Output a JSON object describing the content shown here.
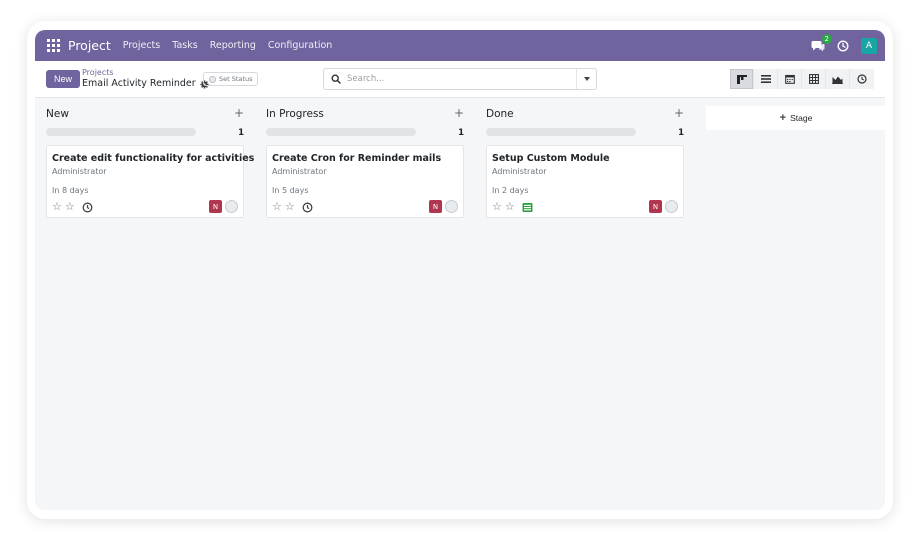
{
  "navbar": {
    "app_name": "Project",
    "menu": [
      "Projects",
      "Tasks",
      "Reporting",
      "Configuration"
    ],
    "chat_count": "2",
    "avatar_letter": "A",
    "color": "#71639e"
  },
  "control": {
    "new_label": "New",
    "breadcrumb_parent": "Projects",
    "breadcrumb_current": "Email Activity Reminder",
    "set_status_label": "Set Status",
    "search_placeholder": "Search..."
  },
  "views": [
    "kanban-icon",
    "list-icon",
    "calendar-icon",
    "pivot-icon",
    "graph-icon",
    "activity-icon"
  ],
  "kanban": {
    "add_stage_label": "Stage",
    "columns": [
      {
        "title": "New",
        "count": "1",
        "card": {
          "title": "Create edit functionality for activities",
          "user": "Administrator",
          "deadline": "In 8 days",
          "activity": "clock-icon",
          "avatar": "N"
        }
      },
      {
        "title": "In Progress",
        "count": "1",
        "card": {
          "title": "Create Cron for Reminder mails",
          "user": "Administrator",
          "deadline": "In 5 days",
          "activity": "clock-icon",
          "avatar": "N"
        }
      },
      {
        "title": "Done",
        "count": "1",
        "card": {
          "title": "Setup Custom Module",
          "user": "Administrator",
          "deadline": "In 2 days",
          "activity": "activity-list-icon",
          "avatar": "N"
        }
      }
    ]
  }
}
